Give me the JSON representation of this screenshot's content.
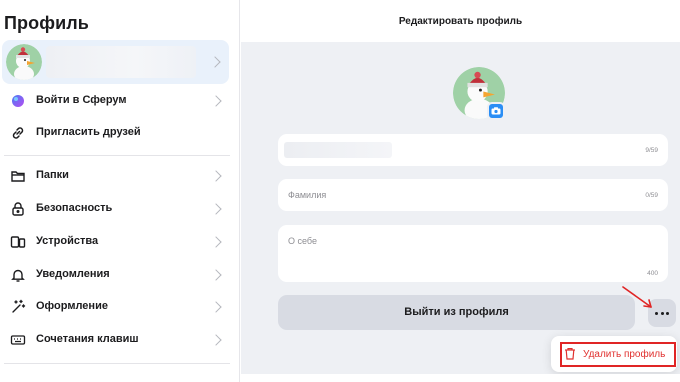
{
  "sidebar": {
    "title": "Профиль",
    "items": [
      {
        "label": "Войти в Сферум",
        "icon": "sferum-logo-icon",
        "chevron": true
      },
      {
        "label": "Пригласить друзей",
        "icon": "link-icon",
        "chevron": false
      },
      {
        "label": "Папки",
        "icon": "folder-icon",
        "chevron": true
      },
      {
        "label": "Безопасность",
        "icon": "lock-icon",
        "chevron": true
      },
      {
        "label": "Устройства",
        "icon": "devices-icon",
        "chevron": true
      },
      {
        "label": "Уведомления",
        "icon": "bell-icon",
        "chevron": true
      },
      {
        "label": "Оформление",
        "icon": "magic-wand-icon",
        "chevron": true
      },
      {
        "label": "Сочетания клавиш",
        "icon": "keyboard-icon",
        "chevron": true
      }
    ]
  },
  "editor": {
    "title": "Редактировать профиль",
    "first_name": {
      "counter": "9/59"
    },
    "last_name": {
      "placeholder": "Фамилия",
      "counter": "0/59"
    },
    "about": {
      "placeholder": "О себе",
      "counter": "400"
    },
    "logout_label": "Выйти из профиля",
    "more_label": "...",
    "delete_label": "Удалить профиль"
  },
  "colors": {
    "accent": "#2a8ef5",
    "danger": "#e0312f",
    "selected_bg": "#e9f1fb",
    "panel_bg": "#eef0f4"
  }
}
